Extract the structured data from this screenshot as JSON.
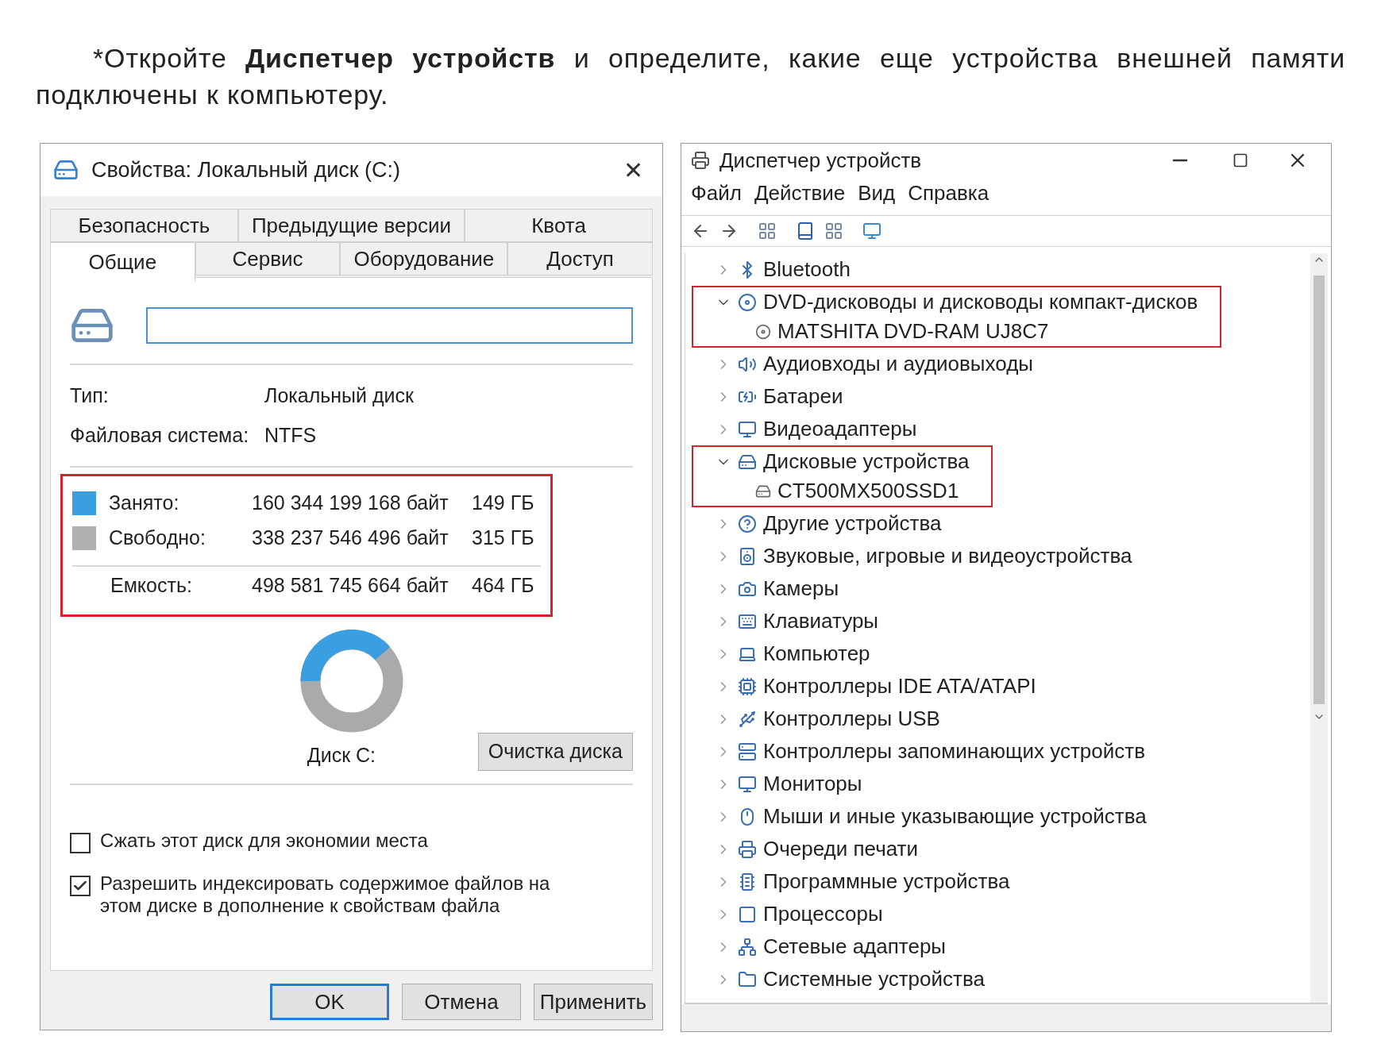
{
  "instruction": "*Откройте **Диспетчер устройств** и определите, какие еще устройства внешней памяти подключены к компьютеру.",
  "properties_window": {
    "title": "Свойства: Локальный диск (C:)",
    "close": "✕",
    "tab_rows": [
      [
        {
          "label": "Безопасность",
          "selected": false
        },
        {
          "label": "Предыдущие версии",
          "selected": false
        },
        {
          "label": "Квота",
          "selected": false
        }
      ],
      [
        {
          "label": "Общие",
          "selected": true
        },
        {
          "label": "Сервис",
          "selected": false
        },
        {
          "label": "Оборудование",
          "selected": false
        },
        {
          "label": "Доступ",
          "selected": false
        }
      ]
    ],
    "info": [
      {
        "label": "Тип:",
        "value": "Локальный диск"
      },
      {
        "label": "Файловая система:",
        "value": "NTFS"
      }
    ],
    "usage": {
      "highlighted": true,
      "rows": [
        {
          "label": "Занято:",
          "bytes": "160 344 199 168 байт",
          "size": "149 ГБ",
          "color": "#3a9fe0"
        },
        {
          "label": "Свободно:",
          "bytes": "338 237 546 496 байт",
          "size": "315 ГБ",
          "color": "#b0b0b0"
        }
      ],
      "total": {
        "label": "Емкость:",
        "bytes": "498 581 745 664 байт",
        "size": "464 ГБ"
      }
    },
    "disk_label": "Диск C:",
    "cleanup_button": "Очистка диска",
    "options": [
      {
        "label": "Сжать этот диск для экономии места",
        "checked": false
      },
      {
        "label": "Разрешить индексировать содержимое файлов на этом диске в дополнение к свойствам файла",
        "checked": true
      }
    ],
    "buttons": [
      {
        "label": "OK",
        "default": true
      },
      {
        "label": "Отмена",
        "default": false
      },
      {
        "label": "Применить",
        "default": false
      }
    ]
  },
  "device_manager": {
    "title": "Диспетчер устройств",
    "menu": [
      "Файл",
      "Действие",
      "Вид",
      "Справка"
    ],
    "tree": [
      {
        "label": "Bluetooth",
        "expanded": false,
        "highlighted": false
      },
      {
        "label": "DVD-дисководы и дисководы компакт-дисков",
        "expanded": true,
        "highlighted": true,
        "children": [
          {
            "label": "MATSHITA DVD-RAM UJ8C7"
          }
        ]
      },
      {
        "label": "Аудиовходы и аудиовыходы",
        "expanded": false,
        "highlighted": false
      },
      {
        "label": "Батареи",
        "expanded": false,
        "highlighted": false
      },
      {
        "label": "Видеоадаптеры",
        "expanded": false,
        "highlighted": false
      },
      {
        "label": "Дисковые устройства",
        "expanded": true,
        "highlighted": true,
        "children": [
          {
            "label": "CT500MX500SSD1"
          }
        ]
      },
      {
        "label": "Другие устройства",
        "expanded": false,
        "highlighted": false
      },
      {
        "label": "Звуковые, игровые и видеоустройства",
        "expanded": false,
        "highlighted": false
      },
      {
        "label": "Камеры",
        "expanded": false,
        "highlighted": false
      },
      {
        "label": "Клавиатуры",
        "expanded": false,
        "highlighted": false
      },
      {
        "label": "Компьютер",
        "expanded": false,
        "highlighted": false
      },
      {
        "label": "Контроллеры IDE ATA/ATAPI",
        "expanded": false,
        "highlighted": false
      },
      {
        "label": "Контроллеры USB",
        "expanded": false,
        "highlighted": false
      },
      {
        "label": "Контроллеры запоминающих устройств",
        "expanded": false,
        "highlighted": false
      },
      {
        "label": "Мониторы",
        "expanded": false,
        "highlighted": false
      },
      {
        "label": "Мыши и иные указывающие устройства",
        "expanded": false,
        "highlighted": false
      },
      {
        "label": "Очереди печати",
        "expanded": false,
        "highlighted": false
      },
      {
        "label": "Программные устройства",
        "expanded": false,
        "highlighted": false
      },
      {
        "label": "Процессоры",
        "expanded": false,
        "highlighted": false
      },
      {
        "label": "Сетевые адаптеры",
        "expanded": false,
        "highlighted": false
      },
      {
        "label": "Системные устройства",
        "expanded": false,
        "highlighted": false
      }
    ]
  }
}
